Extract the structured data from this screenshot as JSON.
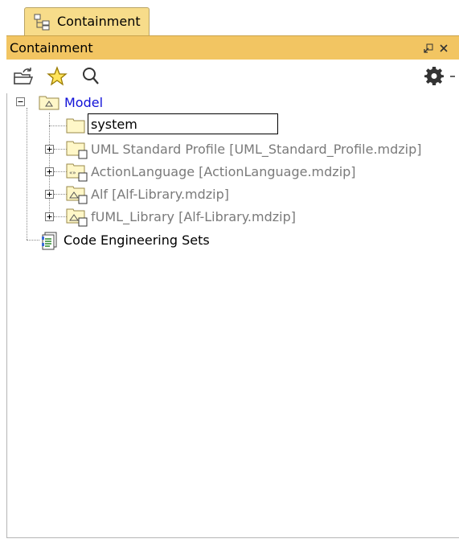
{
  "tab": {
    "label": "Containment",
    "icon": "containment-tree-icon"
  },
  "panel": {
    "title": "Containment",
    "pin_icon": "pin-icon",
    "close_icon": "close-icon"
  },
  "toolbar": {
    "icons": [
      "open-folder-icon",
      "star-icon",
      "search-icon",
      "gear-icon",
      "dropdown-arrow-icon"
    ]
  },
  "tree": {
    "root": {
      "label": "Model",
      "expanded": true
    },
    "children": [
      {
        "label": "system",
        "editing": true
      },
      {
        "label": "UML Standard Profile [UML_Standard_Profile.mdzip]",
        "expanded": false
      },
      {
        "label": "ActionLanguage [ActionLanguage.mdzip]",
        "expanded": false
      },
      {
        "label": "Alf [Alf-Library.mdzip]",
        "expanded": false
      },
      {
        "label": "fUML_Library [Alf-Library.mdzip]",
        "expanded": false
      }
    ],
    "sibling": {
      "label": "Code Engineering Sets"
    }
  },
  "colors": {
    "tab_bg": "#f7dc8a",
    "header_bg": "#f2c562",
    "model_label": "#1010d8",
    "used_project_label": "#7a7a7a"
  }
}
